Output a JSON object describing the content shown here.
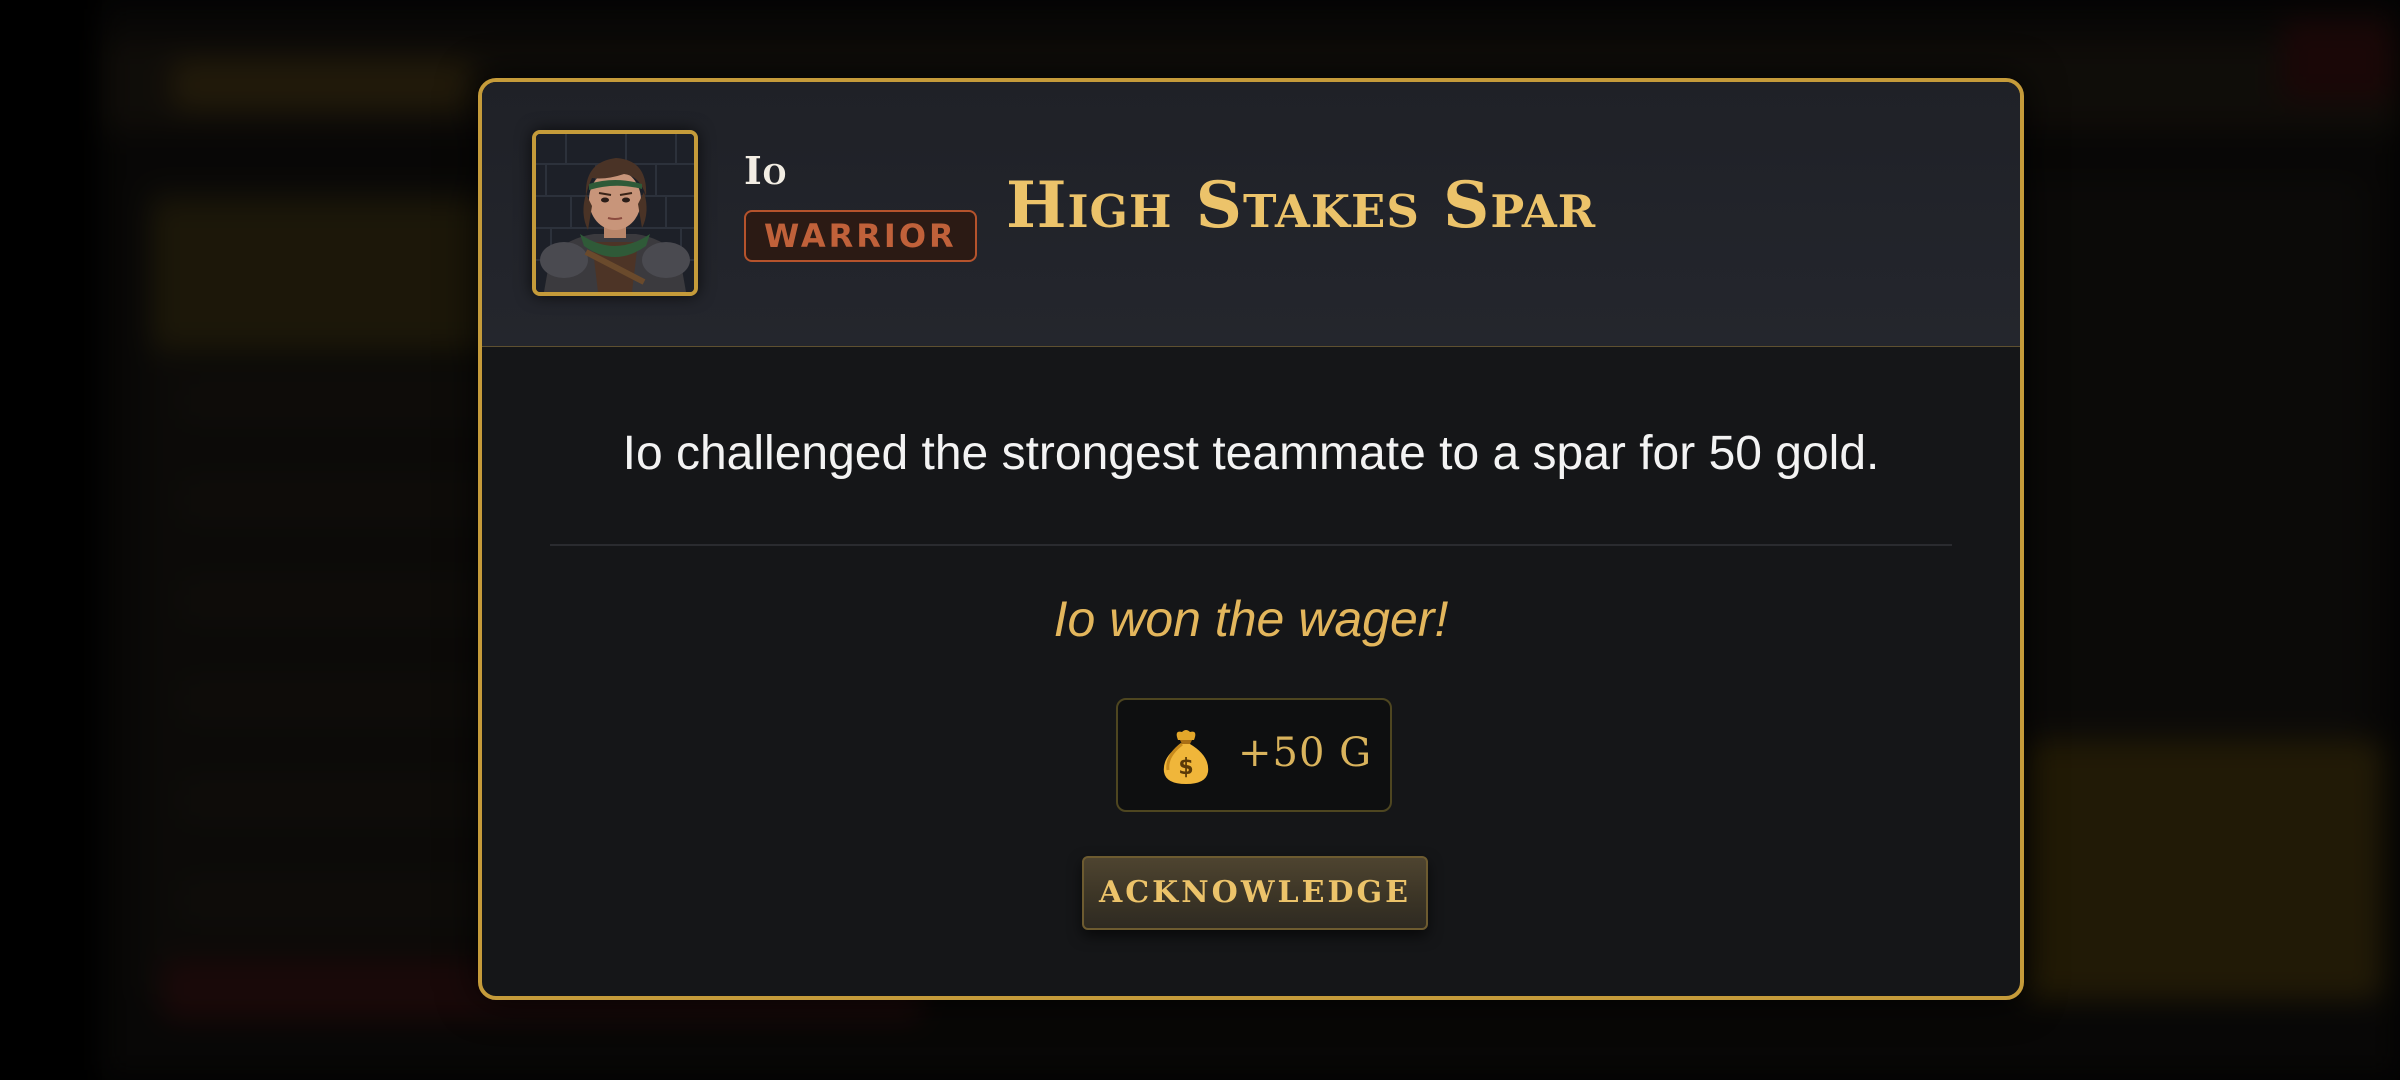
{
  "event": {
    "title": "High Stakes Spar",
    "description": "Io challenged the strongest teammate to a spar for 50 gold.",
    "result": "Io won the wager!"
  },
  "hero": {
    "name": "Io",
    "class_label": "WARRIOR",
    "portrait_icon": "warrior-portrait"
  },
  "reward": {
    "icon": "money-bag-icon",
    "value": "+50 G"
  },
  "actions": {
    "acknowledge_label": "ACKNOWLEDGE"
  },
  "colors": {
    "gold_border": "#c59b3a",
    "title_gold": "#ecc36a",
    "result_gold": "#e3b65c",
    "class_badge": "#c0613a"
  }
}
